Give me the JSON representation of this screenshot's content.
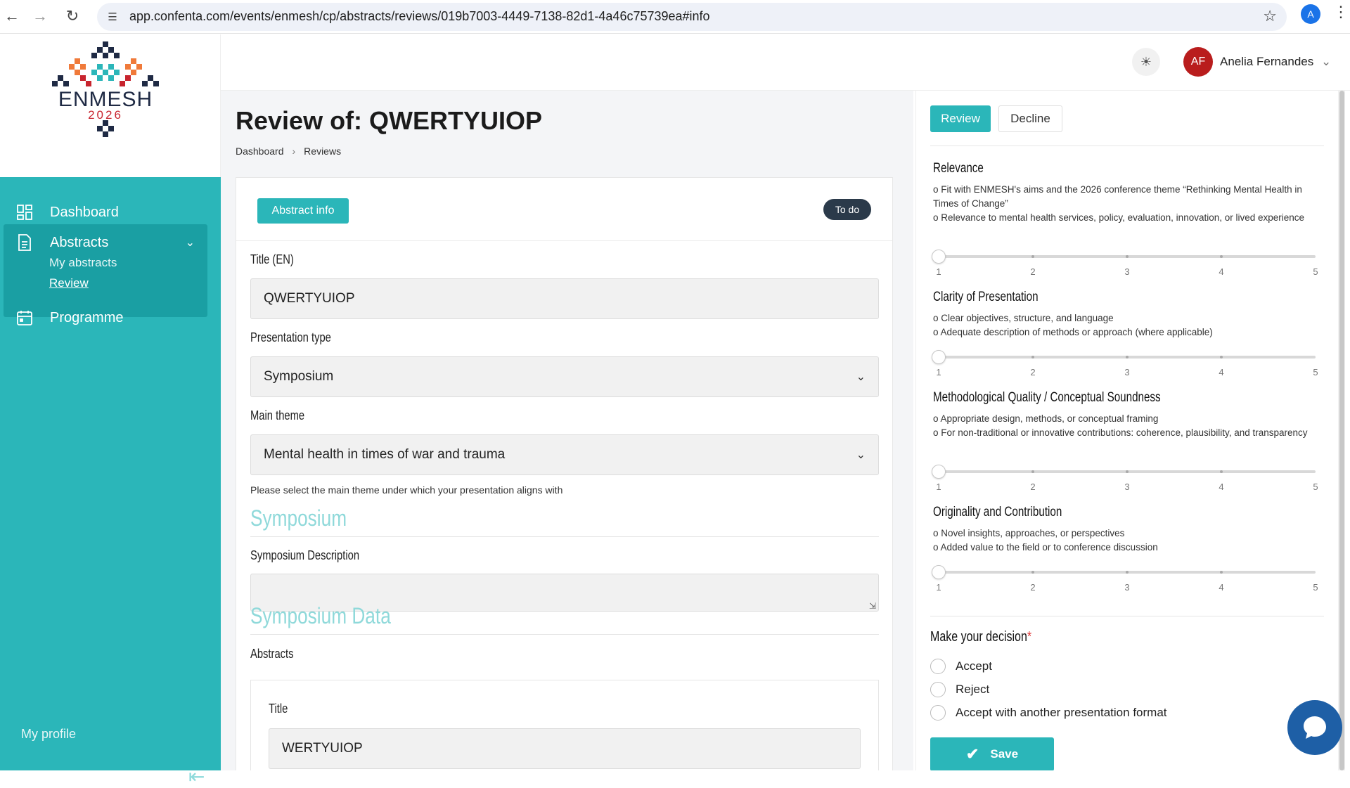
{
  "browser": {
    "url": "app.confenta.com/events/enmesh/cp/abstracts/reviews/019b7003-4449-7138-82d1-4a46c75739ea#info",
    "profile_initial": "A"
  },
  "logo": {
    "name": "ENMESH",
    "year": "2026"
  },
  "sidebar": {
    "items": [
      {
        "label": "Dashboard",
        "icon": "grid-icon"
      },
      {
        "label": "Abstracts",
        "icon": "document-icon",
        "expanded": true,
        "children": [
          {
            "label": "My abstracts"
          },
          {
            "label": "Review",
            "active": true
          }
        ]
      },
      {
        "label": "Programme",
        "icon": "calendar-icon"
      }
    ],
    "footer": {
      "my_profile": "My profile"
    }
  },
  "topbar": {
    "user_initials": "AF",
    "user_name": "Anelia Fernandes"
  },
  "page": {
    "title": "Review of: QWERTYUIOP",
    "breadcrumb": [
      "Dashboard",
      "Reviews"
    ]
  },
  "form": {
    "tab_label": "Abstract info",
    "status_badge": "To do",
    "title_label": "Title (EN)",
    "title_value": "QWERTYUIOP",
    "presentation_type_label": "Presentation type",
    "presentation_type_value": "Symposium",
    "main_theme_label": "Main theme",
    "main_theme_value": "Mental health in times of war and trauma",
    "main_theme_help": "Please select the main theme under which your presentation aligns with",
    "section_symposium": "Symposium",
    "symposium_description_label": "Symposium Description",
    "symposium_description_value": "",
    "section_symposium_data": "Symposium Data",
    "abstracts_label": "Abstracts",
    "inner_title_label": "Title",
    "inner_title_value": "WERTYUIOP"
  },
  "review": {
    "tabs": {
      "review": "Review",
      "decline": "Decline"
    },
    "criteria": [
      {
        "title": "Relevance",
        "lines": [
          "o Fit with ENMESH's aims and the 2026 conference theme “Rethinking Mental Health in Times of Change”",
          "o Relevance to mental health services, policy, evaluation, innovation, or lived experience"
        ],
        "value": 1
      },
      {
        "title": "Clarity of Presentation",
        "lines": [
          "o Clear objectives, structure, and language",
          "o Adequate description of methods or approach (where applicable)"
        ],
        "value": 1
      },
      {
        "title": "Methodological Quality / Conceptual Soundness",
        "lines": [
          "o Appropriate design, methods, or conceptual framing",
          "o For non-traditional or innovative contributions: coherence, plausibility, and transparency"
        ],
        "value": 1
      },
      {
        "title": "Originality and Contribution",
        "lines": [
          "o Novel insights, approaches, or perspectives",
          "o Added value to the field or to conference discussion"
        ],
        "value": 1
      }
    ],
    "scale": [
      "1",
      "2",
      "3",
      "4",
      "5"
    ],
    "decision_label": "Make your decision",
    "required_mark": "*",
    "options": [
      "Accept",
      "Reject",
      "Accept with another presentation format"
    ],
    "save_label": "Save"
  },
  "colors": {
    "accent": "#2bb6b9",
    "accent_dark": "#1a9fa3",
    "avatar": "#b91d1d",
    "badge": "#2b3a4a",
    "chat": "#1e5fa6"
  }
}
